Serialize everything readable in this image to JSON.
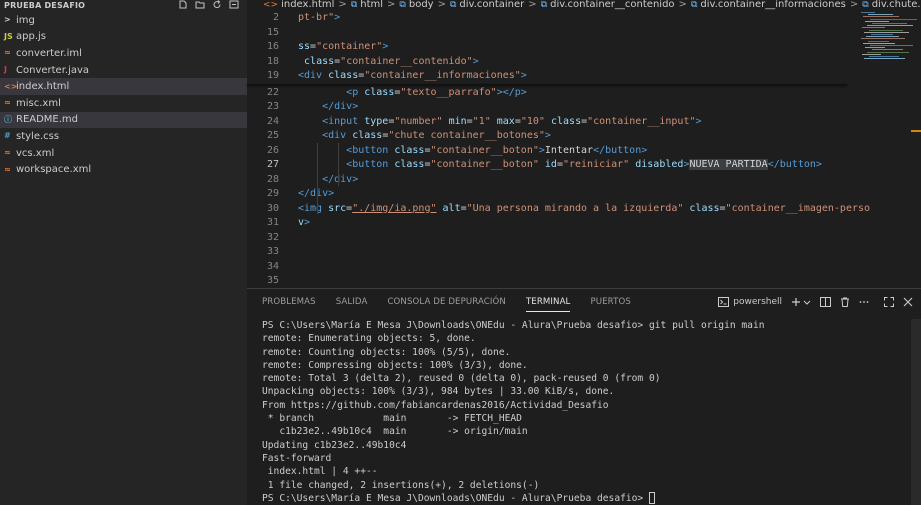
{
  "explorer": {
    "title": "PRUEBA DESAFIO",
    "files": [
      {
        "name": "img",
        "icon": ">",
        "icon_color": "#cccccc",
        "active": false
      },
      {
        "name": "app.js",
        "icon": "JS",
        "icon_color": "#cbcb41",
        "active": false
      },
      {
        "name": "converter.iml",
        "icon": "≈",
        "icon_color": "#e37933",
        "active": false
      },
      {
        "name": "Converter.java",
        "icon": "J",
        "icon_color": "#cc3e44",
        "active": false
      },
      {
        "name": "index.html",
        "icon": "<>",
        "icon_color": "#e37933",
        "active": true
      },
      {
        "name": "misc.xml",
        "icon": "≈",
        "icon_color": "#e37933",
        "active": false
      },
      {
        "name": "README.md",
        "icon": "ⓘ",
        "icon_color": "#519aba",
        "active": true
      },
      {
        "name": "style.css",
        "icon": "#",
        "icon_color": "#519aba",
        "active": false
      },
      {
        "name": "vcs.xml",
        "icon": "≈",
        "icon_color": "#e37933",
        "active": false
      },
      {
        "name": "workspace.xml",
        "icon": "≈",
        "icon_color": "#e37933",
        "active": false
      }
    ]
  },
  "breadcrumb": [
    {
      "label": "index.html",
      "icon": "<>"
    },
    {
      "label": "html",
      "icon": "⧉"
    },
    {
      "label": "body",
      "icon": "⧉"
    },
    {
      "label": "div.container",
      "icon": "⧉"
    },
    {
      "label": "div.container__contenido",
      "icon": "⧉"
    },
    {
      "label": "div.container__informaciones",
      "icon": "⧉"
    },
    {
      "label": "div.chute.container__boto",
      "icon": "⧉"
    }
  ],
  "code_lines": [
    {
      "n": "2",
      "tokens": [
        [
          "t-str",
          "pt-br\""
        ],
        [
          "t-tag",
          ">"
        ]
      ]
    },
    {
      "n": "15",
      "tokens": []
    },
    {
      "n": "16",
      "tokens": [
        [
          "t-attr",
          "ss"
        ],
        [
          "t-txt",
          "="
        ],
        [
          "t-str",
          "\"container\""
        ],
        [
          "t-tag",
          ">"
        ]
      ]
    },
    {
      "n": "18",
      "tokens": [
        [
          "t-txt",
          " "
        ],
        [
          "t-attr",
          "class"
        ],
        [
          "t-txt",
          "="
        ],
        [
          "t-str",
          "\"container__contenido\""
        ],
        [
          "t-tag",
          ">"
        ]
      ]
    },
    {
      "n": "19",
      "tokens": [
        [
          "t-tag",
          "<div "
        ],
        [
          "t-attr",
          "class"
        ],
        [
          "t-txt",
          "="
        ],
        [
          "t-str",
          "\"container__informaciones\""
        ],
        [
          "t-tag",
          ">"
        ]
      ]
    },
    {
      "n": "22",
      "tokens": [
        [
          "t-txt",
          "        "
        ],
        [
          "t-tag",
          "<p "
        ],
        [
          "t-attr",
          "class"
        ],
        [
          "t-txt",
          "="
        ],
        [
          "t-str",
          "\"texto__parrafo\""
        ],
        [
          "t-tag",
          "></p>"
        ]
      ]
    },
    {
      "n": "23",
      "tokens": [
        [
          "t-txt",
          "    "
        ],
        [
          "t-tag",
          "</div>"
        ]
      ]
    },
    {
      "n": "24",
      "tokens": [
        [
          "t-txt",
          "    "
        ],
        [
          "t-tag",
          "<input "
        ],
        [
          "t-attr",
          "type"
        ],
        [
          "t-txt",
          "="
        ],
        [
          "t-str",
          "\"number\""
        ],
        [
          "t-txt",
          " "
        ],
        [
          "t-attr",
          "min"
        ],
        [
          "t-txt",
          "="
        ],
        [
          "t-str",
          "\"1\""
        ],
        [
          "t-txt",
          " "
        ],
        [
          "t-attr",
          "max"
        ],
        [
          "t-txt",
          "="
        ],
        [
          "t-str",
          "\"10\""
        ],
        [
          "t-txt",
          " "
        ],
        [
          "t-attr",
          "class"
        ],
        [
          "t-txt",
          "="
        ],
        [
          "t-str",
          "\"container__input\""
        ],
        [
          "t-tag",
          ">"
        ]
      ]
    },
    {
      "n": "25",
      "tokens": [
        [
          "t-txt",
          "    "
        ],
        [
          "t-tag",
          "<div "
        ],
        [
          "t-attr",
          "class"
        ],
        [
          "t-txt",
          "="
        ],
        [
          "t-str",
          "\"chute container__botones\""
        ],
        [
          "t-tag",
          ">"
        ]
      ]
    },
    {
      "n": "26",
      "tokens": [
        [
          "t-txt",
          "        "
        ],
        [
          "t-tag",
          "<button "
        ],
        [
          "t-attr",
          "class"
        ],
        [
          "t-txt",
          "="
        ],
        [
          "t-str",
          "\"container__boton\""
        ],
        [
          "t-tag",
          ">"
        ],
        [
          "t-txt",
          "Intentar"
        ],
        [
          "t-tag",
          "</button>"
        ]
      ]
    },
    {
      "n": "27",
      "tokens": [
        [
          "t-txt",
          "        "
        ],
        [
          "t-tag",
          "<button "
        ],
        [
          "t-attr",
          "class"
        ],
        [
          "t-txt",
          "="
        ],
        [
          "t-str",
          "\"container__boton\""
        ],
        [
          "t-txt",
          " "
        ],
        [
          "t-attr",
          "id"
        ],
        [
          "t-txt",
          "="
        ],
        [
          "t-str",
          "\"reiniciar\""
        ],
        [
          "t-txt",
          " "
        ],
        [
          "t-attr",
          "disabled"
        ],
        [
          "t-tag",
          ">"
        ],
        [
          "t-sel",
          "NUEVA PARTIDA"
        ],
        [
          "t-tag",
          "</button>"
        ]
      ]
    },
    {
      "n": "28",
      "tokens": [
        [
          "t-txt",
          "    "
        ],
        [
          "t-tag",
          "</div>"
        ]
      ]
    },
    {
      "n": "29",
      "tokens": [
        [
          "t-tag",
          "</div>"
        ]
      ]
    },
    {
      "n": "30",
      "tokens": [
        [
          "t-tag",
          "<img "
        ],
        [
          "t-attr",
          "src"
        ],
        [
          "t-txt",
          "="
        ],
        [
          "t-str",
          "\"./img/ia.png\""
        ],
        [
          "t-txt",
          " "
        ],
        [
          "t-attr",
          "alt"
        ],
        [
          "t-txt",
          "="
        ],
        [
          "t-str",
          "\"Una persona mirando a la izquierda\""
        ],
        [
          "t-txt",
          " "
        ],
        [
          "t-attr",
          "class"
        ],
        [
          "t-txt",
          "="
        ],
        [
          "t-str",
          "\"container__imagen-perso"
        ]
      ]
    },
    {
      "n": "31",
      "tokens": [
        [
          "t-attr",
          "v"
        ],
        [
          "t-tag",
          ">"
        ]
      ]
    },
    {
      "n": "32",
      "tokens": []
    },
    {
      "n": "33",
      "tokens": []
    },
    {
      "n": "34",
      "tokens": []
    },
    {
      "n": "35",
      "tokens": []
    }
  ],
  "panel": {
    "tabs": [
      "PROBLEMAS",
      "SALIDA",
      "CONSOLA DE DEPURACIÓN",
      "TERMINAL",
      "PUERTOS"
    ],
    "active_tab": "TERMINAL",
    "shell": "powershell"
  },
  "terminal_lines": [
    "PS C:\\Users\\María E Mesa J\\Downloads\\ONEdu - Alura\\Prueba desafio> git pull origin main",
    "remote: Enumerating objects: 5, done.",
    "remote: Counting objects: 100% (5/5), done.",
    "remote: Compressing objects: 100% (3/3), done.",
    "remote: Total 3 (delta 2), reused 0 (delta 0), pack-reused 0 (from 0)",
    "Unpacking objects: 100% (3/3), 984 bytes | 33.00 KiB/s, done.",
    "From https://github.com/fabiancardenas2016/Actividad_Desafio",
    " * branch            main       -> FETCH_HEAD",
    "   c1b23e2..49b10c4  main       -> origin/main",
    "Updating c1b23e2..49b10c4",
    "Fast-forward",
    " index.html | 4 ++--",
    " 1 file changed, 2 insertions(+), 2 deletions(-)",
    "PS C:\\Users\\María E Mesa J\\Downloads\\ONEdu - Alura\\Prueba desafio> "
  ]
}
